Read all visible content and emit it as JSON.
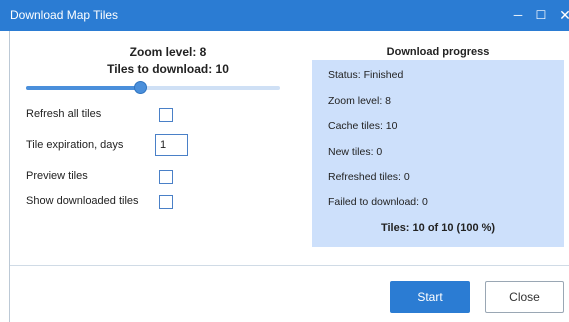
{
  "window": {
    "title": "Download Map Tiles",
    "controls": {
      "minimize": "─",
      "maximize": "☐",
      "close": "✕"
    }
  },
  "settings": {
    "zoom_label": "Zoom level: 8",
    "tiles_label": "Tiles to download: 10",
    "zoom_slider_fraction": 0.45,
    "options": [
      {
        "label": "Refresh all tiles",
        "checked": false
      },
      {
        "label": "Tile expiration, days",
        "value": "1"
      },
      {
        "label": "Preview tiles",
        "checked": false
      },
      {
        "label": "Show downloaded tiles",
        "checked": false
      }
    ]
  },
  "progress": {
    "title": "Download progress",
    "lines": [
      "Status: Finished",
      "Zoom level: 8",
      "Cache tiles: 10",
      "New tiles: 0",
      "Refreshed tiles: 0",
      "Failed to download: 0"
    ],
    "total": "Tiles: 10 of 10 (100 %)"
  },
  "buttons": {
    "start": "Start",
    "close": "Close"
  },
  "colors": {
    "accent": "#2b7cd3",
    "panel": "#cde0fb"
  }
}
